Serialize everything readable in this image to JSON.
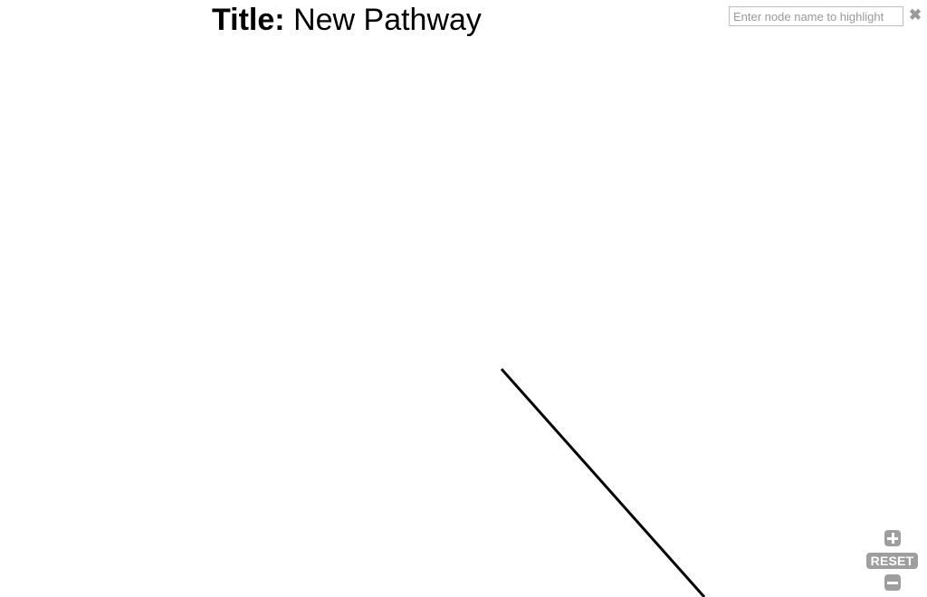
{
  "header": {
    "title_label": "Title:",
    "title_value": "New Pathway"
  },
  "search": {
    "placeholder": "Enter node name to highlight",
    "value": "",
    "clear_glyph": "✖"
  },
  "zoom_controls": {
    "zoom_in_icon": "plus-icon",
    "reset_label": "RESET",
    "zoom_out_icon": "minus-icon",
    "button_color": "#9e9e9e"
  },
  "diagram": {
    "edge_color": "#000000"
  }
}
